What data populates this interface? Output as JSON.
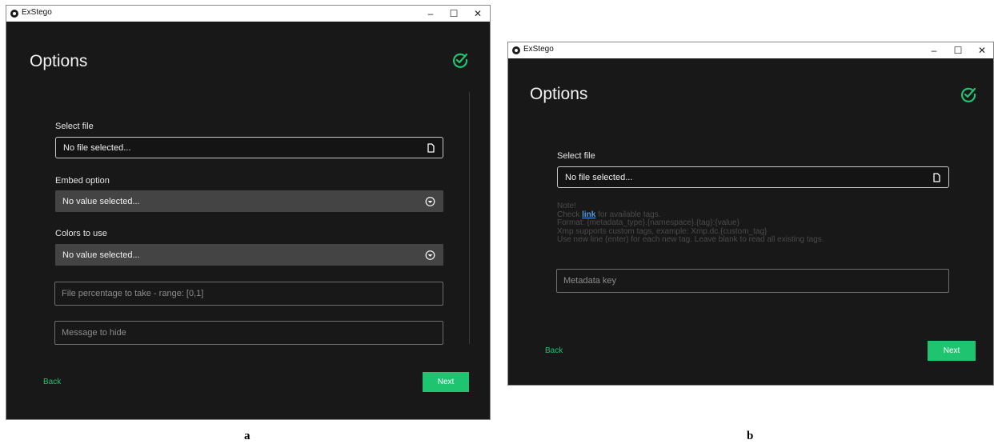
{
  "colors": {
    "accent": "#1fc471",
    "background": "#181818",
    "select_bg": "#444444",
    "link": "#4d9be6"
  },
  "panel_a": {
    "window": {
      "title": "ExStego",
      "minimize": "–",
      "maximize": "☐",
      "close": "✕"
    },
    "page_title": "Options",
    "header_icon": "check-circle-icon",
    "select_file": {
      "label": "Select file",
      "value": "No file selected...",
      "icon": "file-icon"
    },
    "embed_option": {
      "label": "Embed option",
      "value": "No value selected...",
      "icon": "chevron-down-circle-icon"
    },
    "colors_to_use": {
      "label": "Colors to use",
      "value": "No value selected...",
      "icon": "chevron-down-circle-icon"
    },
    "percentage_input": {
      "placeholder": "File percentage to take - range: [0,1]"
    },
    "message_input": {
      "placeholder": "Message to hide"
    },
    "back": "Back",
    "next": "Next",
    "caption": "a"
  },
  "panel_b": {
    "window": {
      "title": "ExStego",
      "minimize": "–",
      "maximize": "☐",
      "close": "✕"
    },
    "page_title": "Options",
    "header_icon": "check-circle-icon",
    "select_file": {
      "label": "Select file",
      "value": "No file selected...",
      "icon": "file-icon"
    },
    "note": {
      "line1": "Note!",
      "line2_pre": "Check ",
      "link": "link",
      "line2_post": " for available tags.",
      "line3": "Format: {metadata_type}.{namespace}.{tag}:{value}",
      "line4": "Xmp supports custom tags, example: Xmp.dc.{custom_tag}",
      "line5": "Use new line (enter) for each new tag. Leave blank to read all existing tags."
    },
    "metadata_input": {
      "placeholder": "Metadata key"
    },
    "back": "Back",
    "next": "Next",
    "caption": "b"
  }
}
